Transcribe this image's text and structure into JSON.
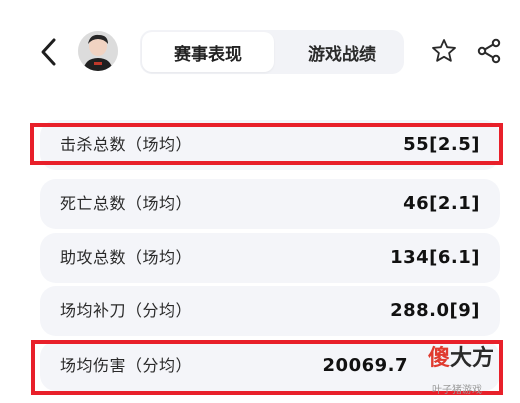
{
  "header": {
    "back_icon": "back-arrow-icon",
    "avatar_icon": "player-avatar",
    "tabs": [
      {
        "label": "赛事表现",
        "active": true
      },
      {
        "label": "游戏战绩",
        "active": false
      }
    ],
    "favorite_icon": "star-icon",
    "share_icon": "share-icon"
  },
  "stats": [
    {
      "label": "击杀总数（场均）",
      "value": "55[2.5]",
      "highlighted": true
    },
    {
      "label": "死亡总数（场均）",
      "value": "46[2.1]",
      "highlighted": false
    },
    {
      "label": "助攻总数（场均）",
      "value": "134[6.1]",
      "highlighted": false
    },
    {
      "label": "场均补刀（分均）",
      "value": "288.0[9]",
      "highlighted": false
    },
    {
      "label": "场均伤害（分均）",
      "value": "20069.7",
      "highlighted": true
    }
  ],
  "watermark": {
    "part1": "傻",
    "part2": "大方",
    "sub": "叶子猪游戏"
  },
  "colors": {
    "highlight": "#e8202a",
    "row_bg": "#f4f5f9",
    "tab_bg": "#f2f3f7",
    "watermark_accent": "#e03a2f"
  }
}
